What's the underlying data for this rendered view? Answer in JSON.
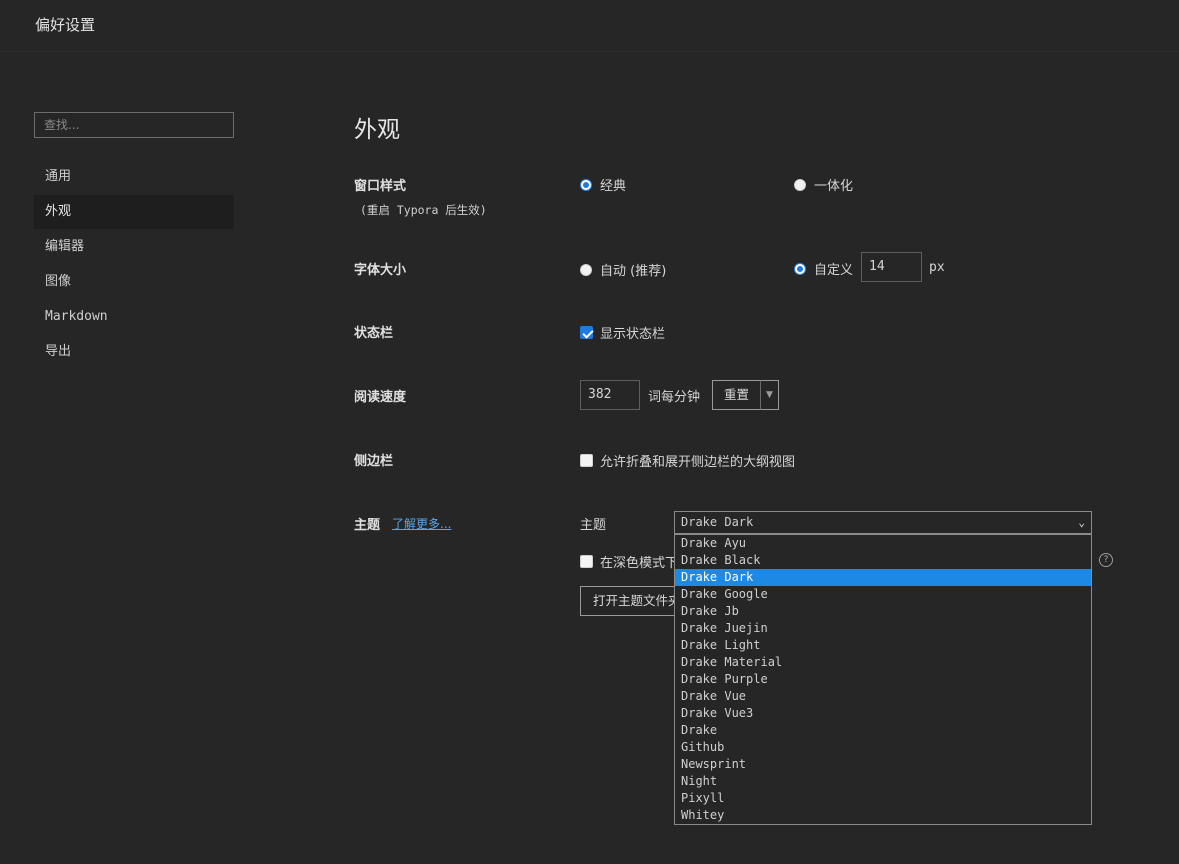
{
  "window": {
    "title": "偏好设置"
  },
  "sidebar": {
    "search_placeholder": "查找...",
    "items": [
      {
        "label": "通用"
      },
      {
        "label": "外观"
      },
      {
        "label": "编辑器"
      },
      {
        "label": "图像"
      },
      {
        "label": "Markdown"
      },
      {
        "label": "导出"
      }
    ]
  },
  "main": {
    "title": "外观",
    "window_style": {
      "label": "窗口样式",
      "note": "(重启 Typora 后生效)",
      "option_classic": "经典",
      "option_unified": "一体化",
      "selected": "经典"
    },
    "font_size": {
      "label": "字体大小",
      "option_auto": "自动 (推荐)",
      "option_custom": "自定义",
      "selected": "自定义",
      "value": "14",
      "unit": "px"
    },
    "status_bar": {
      "label": "状态栏",
      "checkbox_label": "显示状态栏",
      "checked": true
    },
    "reading_speed": {
      "label": "阅读速度",
      "value": "382",
      "unit": "词每分钟",
      "reset_label": "重置",
      "arrow": "▼"
    },
    "sidebar_setting": {
      "label": "侧边栏",
      "checkbox_label": "允许折叠和展开侧边栏的大纲视图",
      "checked": false
    },
    "theme": {
      "label": "主题",
      "learn_more": "了解更多...",
      "select_label": "主题",
      "selected": "Drake Dark",
      "dark_mode_checkbox_label": "在深色模式下",
      "open_folder_label": "打开主题文件夹",
      "help": "?",
      "options": [
        "Drake Ayu",
        "Drake Black",
        "Drake Dark",
        "Drake Google",
        "Drake Jb",
        "Drake Juejin",
        "Drake Light",
        "Drake Material",
        "Drake Purple",
        "Drake Vue",
        "Drake Vue3",
        "Drake",
        "Github",
        "Newsprint",
        "Night",
        "Pixyll",
        "Whitey"
      ]
    }
  }
}
